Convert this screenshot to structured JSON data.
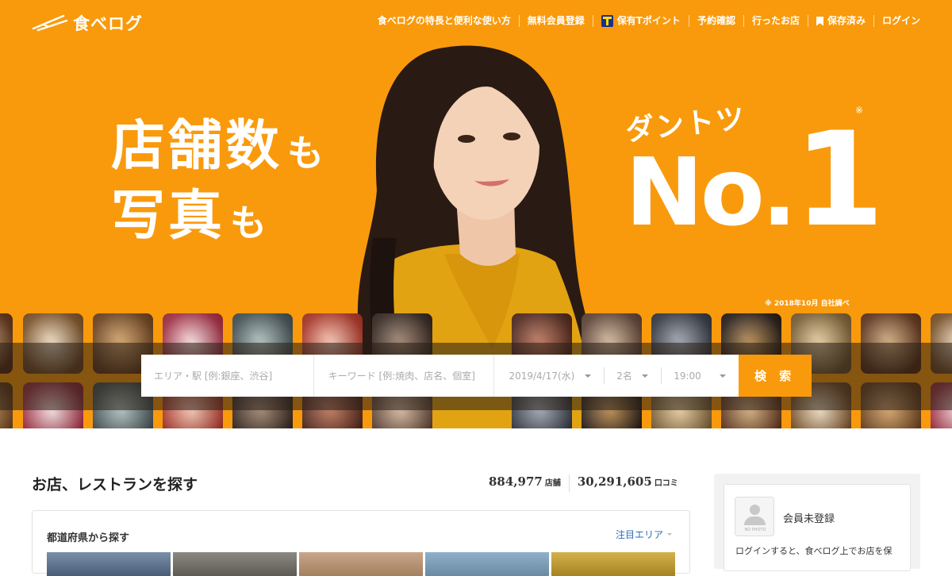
{
  "brand": {
    "name": "食べログ",
    "accent": "#f99a0c"
  },
  "nav": [
    {
      "label": "食べログの特長と便利な使い方",
      "icon": ""
    },
    {
      "label": "無料会員登録",
      "icon": ""
    },
    {
      "label": "保有Tポイント",
      "icon": "t-point-icon"
    },
    {
      "label": "予約確認",
      "icon": ""
    },
    {
      "label": "行ったお店",
      "icon": ""
    },
    {
      "label": "保存済み",
      "icon": "bookmark-icon"
    },
    {
      "label": "ログイン",
      "icon": ""
    }
  ],
  "hero": {
    "line1_big": "店舗数",
    "line1_small": "も",
    "line2_big": "写真",
    "line2_small": "も",
    "dantotsu": "ダントツ",
    "no": "No.",
    "one": "1",
    "kome": "※",
    "survey_note": "※ 2018年10月 自社調べ"
  },
  "search": {
    "area_placeholder": "エリア・駅 [例:銀座、渋谷]",
    "keyword_placeholder": "キーワード [例:焼肉、店名、個室]",
    "date": "2019/4/17(水)",
    "people": "2名",
    "time": "19:00",
    "button": "検 索"
  },
  "main": {
    "section_title": "お店、レストランを探す",
    "stats": [
      {
        "value": "884,977",
        "unit": "店舗"
      },
      {
        "value": "30,291,605",
        "unit": "口コミ"
      }
    ],
    "prefecture_title": "都道府県から探す",
    "featured_area_link": "注目エリア"
  },
  "sidebar": {
    "no_photo": "NO PHOTO",
    "member_status": "会員未登録",
    "member_text": "ログインすると、食べログ上でお店を保"
  }
}
